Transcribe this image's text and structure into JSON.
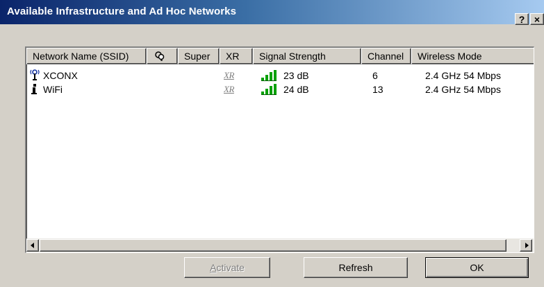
{
  "window": {
    "title": "Available Infrastructure and Ad Hoc Networks",
    "help_label": "?",
    "close_label": "×"
  },
  "list": {
    "columns": [
      {
        "label": "Network Name (SSID)"
      },
      {
        "label": "",
        "icon": "security-keys-icon"
      },
      {
        "label": "Super"
      },
      {
        "label": "XR"
      },
      {
        "label": "Signal Strength"
      },
      {
        "label": "Channel"
      },
      {
        "label": "Wireless Mode"
      }
    ],
    "rows": [
      {
        "type_icon": "access-point-icon",
        "ssid": "XCONX",
        "xr": "XR",
        "signal": "23 dB",
        "signal_bars": 4,
        "channel": "6",
        "mode": "2.4 GHz 54 Mbps"
      },
      {
        "type_icon": "ad-hoc-icon",
        "ssid": "WiFi",
        "xr": "XR",
        "signal": "24 dB",
        "signal_bars": 4,
        "channel": "13",
        "mode": "2.4 GHz 54 Mbps"
      }
    ]
  },
  "buttons": {
    "activate_label": "Activate",
    "activate_access_key": "A",
    "activate_rest": "ctivate",
    "refresh_label": "Refresh",
    "ok_label": "OK"
  },
  "colors": {
    "title_gradient_start": "#0a246a",
    "title_gradient_end": "#a6caf0",
    "signal_green": "#00a000"
  }
}
